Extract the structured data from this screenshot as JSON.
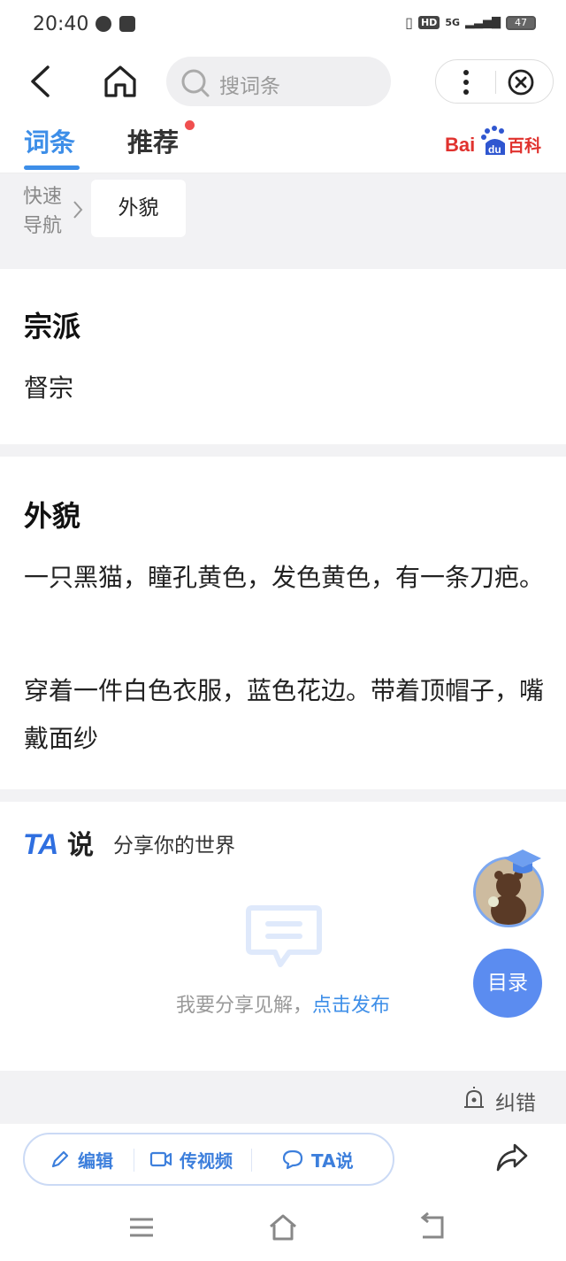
{
  "status_bar": {
    "time": "20:40",
    "hd": "HD",
    "network": "5G",
    "battery": "47"
  },
  "top_nav": {
    "search_placeholder": "搜词条"
  },
  "tabs": [
    {
      "label": "词条"
    },
    {
      "label": "推荐"
    }
  ],
  "brand": {
    "logo_text": "Bai du 百科",
    "accent": "#3d8ee8",
    "logo_red": "#e0322e"
  },
  "quick_nav": {
    "label": "快速导航",
    "items": [
      "外貌"
    ]
  },
  "sections": [
    {
      "title": "宗派",
      "paragraphs": [
        "督宗"
      ]
    },
    {
      "title": "外貌",
      "paragraphs": [
        "一只黑猫，瞳孔黄色，发色黄色，有一条刀疤。",
        "穿着一件白色衣服，蓝色花边。带着顶帽子，嘴戴面纱"
      ]
    }
  ],
  "ta_say": {
    "tagline": "分享你的世界",
    "prompt": "我要分享见解，",
    "link": "点击发布"
  },
  "floating": {
    "toc_label": "目录"
  },
  "report": {
    "label": "纠错"
  },
  "action_bar": {
    "edit": "编辑",
    "video": "传视频",
    "ta": "TA说"
  }
}
